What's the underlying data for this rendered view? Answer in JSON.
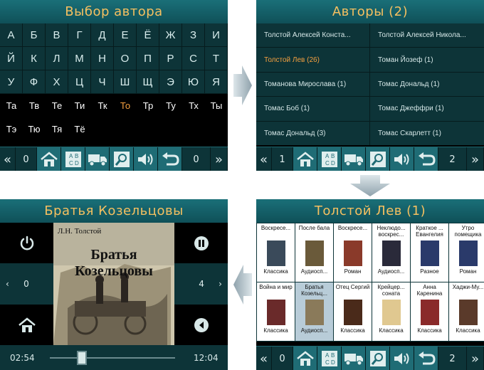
{
  "panel1": {
    "title": "Выбор автора",
    "letters_rows": [
      [
        "А",
        "Б",
        "В",
        "Г",
        "Д",
        "Е",
        "Ё",
        "Ж",
        "З",
        "И"
      ],
      [
        "Й",
        "К",
        "Л",
        "М",
        "Н",
        "О",
        "П",
        "Р",
        "С",
        "Т"
      ],
      [
        "У",
        "Ф",
        "Х",
        "Ц",
        "Ч",
        "Ш",
        "Щ",
        "Ъ",
        "Э",
        "Ю",
        "Я"
      ]
    ],
    "row1": [
      "А",
      "Б",
      "В",
      "Г",
      "Д",
      "Е",
      "Ё",
      "Ж",
      "З",
      "И"
    ],
    "row2": [
      "Й",
      "К",
      "Л",
      "М",
      "Н",
      "О",
      "П",
      "Р",
      "С",
      "Т"
    ],
    "row3": [
      "У",
      "Ф",
      "Х",
      "Ц",
      "Ч",
      "Ш",
      "Щ",
      "Э",
      "Ю",
      "Я"
    ],
    "row4": [
      "Та",
      "Тв",
      "Те",
      "Ти",
      "Тк",
      "То",
      "Тр",
      "Ту",
      "Тх",
      "Ты"
    ],
    "row5": [
      "Тэ",
      "Тю",
      "Тя",
      "Тё"
    ],
    "selected_syllable": "То",
    "page_left": "0",
    "page_right": "0"
  },
  "panel2": {
    "title": "Авторы (2)",
    "authors": [
      "Толстой Алексей Конста...",
      "Толстой Алексей Никола...",
      "Толстой Лев (26)",
      "Томан Йозеф (1)",
      "Томанова Мирослава (1)",
      "Томас Дональд (1)",
      "Томас Боб (1)",
      "Томас Джеффри (1)",
      "Томас Дональд (3)",
      "Томас Скарлетт (1)"
    ],
    "selected_author": "Толстой Лев (26)",
    "page_left": "1",
    "page_right": "2"
  },
  "panel3": {
    "title": "Братья Козельцовы",
    "cover_author": "Л.Н. Толстой",
    "cover_title": "Братья Козельцовы",
    "page_left": "0",
    "page_right": "4",
    "time_elapsed": "02:54",
    "time_total": "12:04",
    "progress": 0.24
  },
  "panel4": {
    "title": "Толстой Лев (1)",
    "books": [
      {
        "title": "Воскресе...",
        "genre": "Классика",
        "color": "#3a4a5a"
      },
      {
        "title": "После бала",
        "genre": "Аудиосп...",
        "color": "#6a5a3a"
      },
      {
        "title": "Воскресе...",
        "genre": "Роман",
        "color": "#8a3a2a"
      },
      {
        "title": "Неклюдо... воскрес...",
        "genre": "Аудиосп...",
        "color": "#2a2a3a"
      },
      {
        "title": "Краткое ... Евангелия",
        "genre": "Разное",
        "color": "#2a3a6a"
      },
      {
        "title": "Утро помещика",
        "genre": "Роман",
        "color": "#2a3a6a"
      },
      {
        "title": "Война и мир",
        "genre": "Классика",
        "color": "#6a2a2a"
      },
      {
        "title": "Братья Козельц...",
        "genre": "Аудиосп...",
        "color": "#8a7a5a"
      },
      {
        "title": "Отец Сергий",
        "genre": "Классика",
        "color": "#4a2a1a"
      },
      {
        "title": "Крейцер... соната",
        "genre": "Классика",
        "color": "#e0c890"
      },
      {
        "title": "Анна Каренина",
        "genre": "Классика",
        "color": "#8a2a2a"
      },
      {
        "title": "Хаджи-Му...",
        "genre": "Классика",
        "color": "#5a3a2a"
      }
    ],
    "selected_book_index": 7,
    "page_left": "0",
    "page_right": "2"
  },
  "colors": {
    "title_text": "#f5c060",
    "cell_bg": "#0d3438",
    "toolbar_bg": "#0d3438",
    "highlight": "#f5a040",
    "arrow": "#a8bac4"
  }
}
